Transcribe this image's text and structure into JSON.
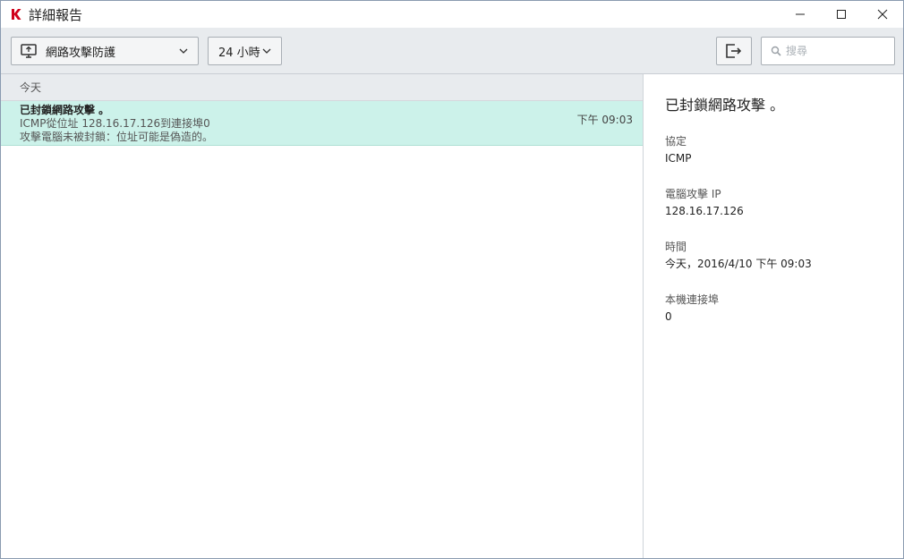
{
  "window": {
    "title": "詳細報告",
    "controls": {
      "minimize": "minimize-icon",
      "maximize": "maximize-icon",
      "close": "close-icon"
    },
    "accent_color": "#d0021b"
  },
  "toolbar": {
    "category": {
      "label": "網路攻擊防護",
      "icon": "monitor-shield-icon"
    },
    "period": {
      "label": "24 小時"
    },
    "export": {
      "icon": "export-icon"
    },
    "search": {
      "placeholder": "搜尋",
      "value": ""
    }
  },
  "list": {
    "group_header": "今天",
    "events": [
      {
        "title": "已封鎖網路攻擊 。",
        "line1": "ICMP從位址 128.16.17.126到連接埠0",
        "line2": "攻擊電腦未被封鎖：位址可能是偽造的。",
        "time": "下午 09:03",
        "selected": true,
        "highlight_color": "#ccf2ea"
      }
    ]
  },
  "detail": {
    "title": "已封鎖網路攻擊 。",
    "fields": [
      {
        "label": "協定",
        "value": "ICMP"
      },
      {
        "label": "電腦攻擊 IP",
        "value": "128.16.17.126"
      },
      {
        "label": "時間",
        "value": "今天，2016/4/10 下午 09:03"
      },
      {
        "label": "本機連接埠",
        "value": "0"
      }
    ]
  }
}
